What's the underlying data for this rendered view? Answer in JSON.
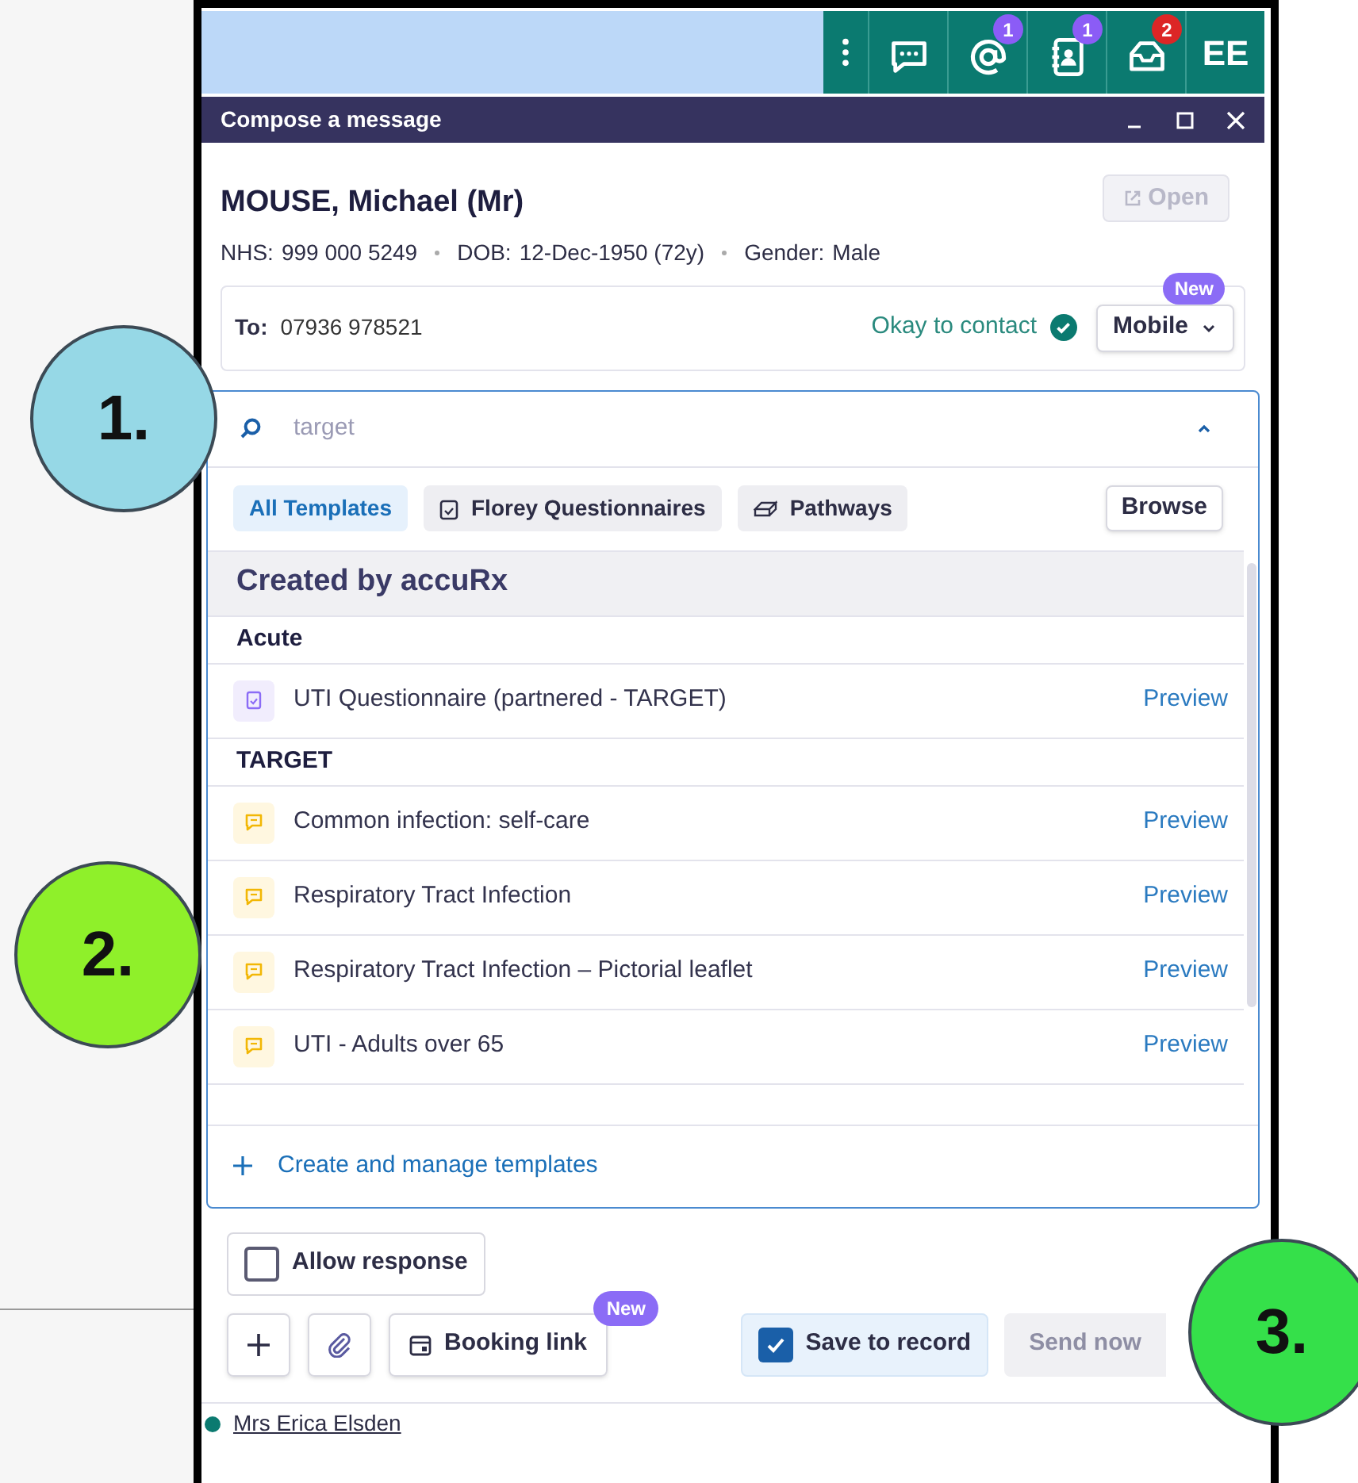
{
  "toolbar": [
    {
      "kind": "menu"
    },
    {
      "kind": "chat"
    },
    {
      "kind": "mention",
      "badge": "1",
      "color": "#8b5cf6"
    },
    {
      "kind": "contacts",
      "badge": "1",
      "color": "#8b5cf6"
    },
    {
      "kind": "inbox",
      "badge": "2",
      "color": "#dc2626"
    },
    {
      "kind": "avatar",
      "label": "EE"
    }
  ],
  "window": {
    "title": "Compose a message"
  },
  "patient": {
    "name": "MOUSE, Michael (Mr)",
    "open_button": {
      "label": "Open",
      "disabled": true
    },
    "details": [
      {
        "label": "NHS:",
        "value": "999 000 5249"
      },
      {
        "label": "DOB:",
        "value": "12-Dec-1950 (72y)"
      },
      {
        "label": "Gender:",
        "value": "Male"
      }
    ]
  },
  "recipient": {
    "label": "To:",
    "value": "07936 978521",
    "status": "Okay to contact",
    "channel": "Mobile",
    "channel_badge": "New"
  },
  "templates": {
    "search": {
      "placeholder": "target"
    },
    "filters": [
      {
        "label": "All Templates",
        "selected": true,
        "kind": "all"
      },
      {
        "label": "Florey Questionnaires",
        "selected": false,
        "kind": "questionnaire"
      },
      {
        "label": "Pathways",
        "selected": false,
        "kind": "pathway"
      }
    ],
    "browse": "Browse",
    "section": "Created by accuRx",
    "groups": [
      {
        "heading": "Acute",
        "items": [
          {
            "kind": "questionnaire",
            "label": "UTI Questionnaire (partnered - TARGET)",
            "action": "Preview"
          }
        ]
      },
      {
        "heading": "TARGET",
        "items": [
          {
            "kind": "message",
            "label": "Common infection: self-care",
            "action": "Preview"
          },
          {
            "kind": "message",
            "label": "Respiratory Tract Infection",
            "action": "Preview"
          },
          {
            "kind": "message",
            "label": "Respiratory Tract Infection – Pictorial leaflet",
            "action": "Preview"
          },
          {
            "kind": "message",
            "label": "UTI - Adults over 65",
            "action": "Preview"
          }
        ]
      }
    ],
    "manage": "Create and manage templates"
  },
  "allow_response": {
    "label": "Allow response",
    "checked": false
  },
  "actions": [
    {
      "kind": "plus"
    },
    {
      "kind": "attach"
    },
    {
      "kind": "booking",
      "label": "Booking link",
      "badge": "New"
    }
  ],
  "save_to_record": {
    "label": "Save to record",
    "checked": true
  },
  "send": {
    "label": "Send now",
    "disabled": true
  },
  "footer": {
    "user": "Mrs Erica Elsden"
  },
  "annotations": [
    {
      "label": "1.",
      "color": "#96d8e6"
    },
    {
      "label": "2.",
      "color": "#8ff02a"
    },
    {
      "label": "3.",
      "color": "#35e04a"
    }
  ]
}
